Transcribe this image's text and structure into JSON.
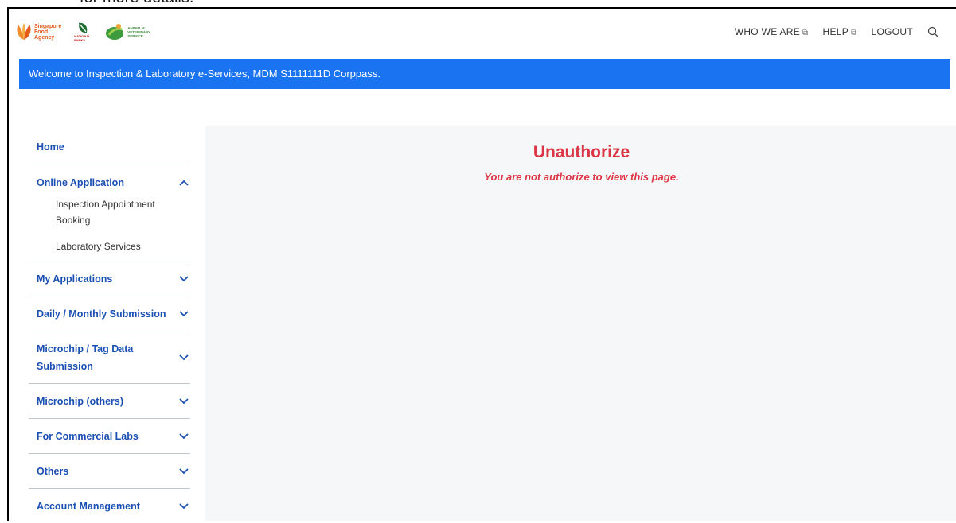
{
  "header": {
    "logos": {
      "sfa_text": [
        "Singapore",
        "Food",
        "Agency"
      ],
      "np_text": "NATIONAL PARKS",
      "avs_text": [
        "ANIMAL &",
        "VETERINARY",
        "SERVICE"
      ]
    },
    "nav": [
      {
        "label": "WHO WE ARE",
        "external": true
      },
      {
        "label": "HELP",
        "external": true
      },
      {
        "label": "LOGOUT",
        "external": false
      }
    ],
    "search_icon": "search-icon"
  },
  "welcome": "Welcome to Inspection & Laboratory e-Services, MDM S1111111D Corppass.",
  "sidebar": {
    "home": "Home",
    "online_application": "Online Application",
    "online_sub": [
      "Inspection Appointment Booking",
      "Laboratory Services"
    ],
    "items": [
      "My Applications",
      "Daily / Monthly Submission",
      "Microchip / Tag Data Submission",
      "Microchip (others)",
      "For Commercial Labs",
      "Others",
      "Account Management"
    ]
  },
  "main": {
    "title": "Unauthorize",
    "message": "You are not authorize to view this page."
  },
  "colors": {
    "accent": "#1a73f0",
    "link": "#1a4fb3",
    "error": "#dc3545",
    "content_bg": "#f5f7f8"
  }
}
